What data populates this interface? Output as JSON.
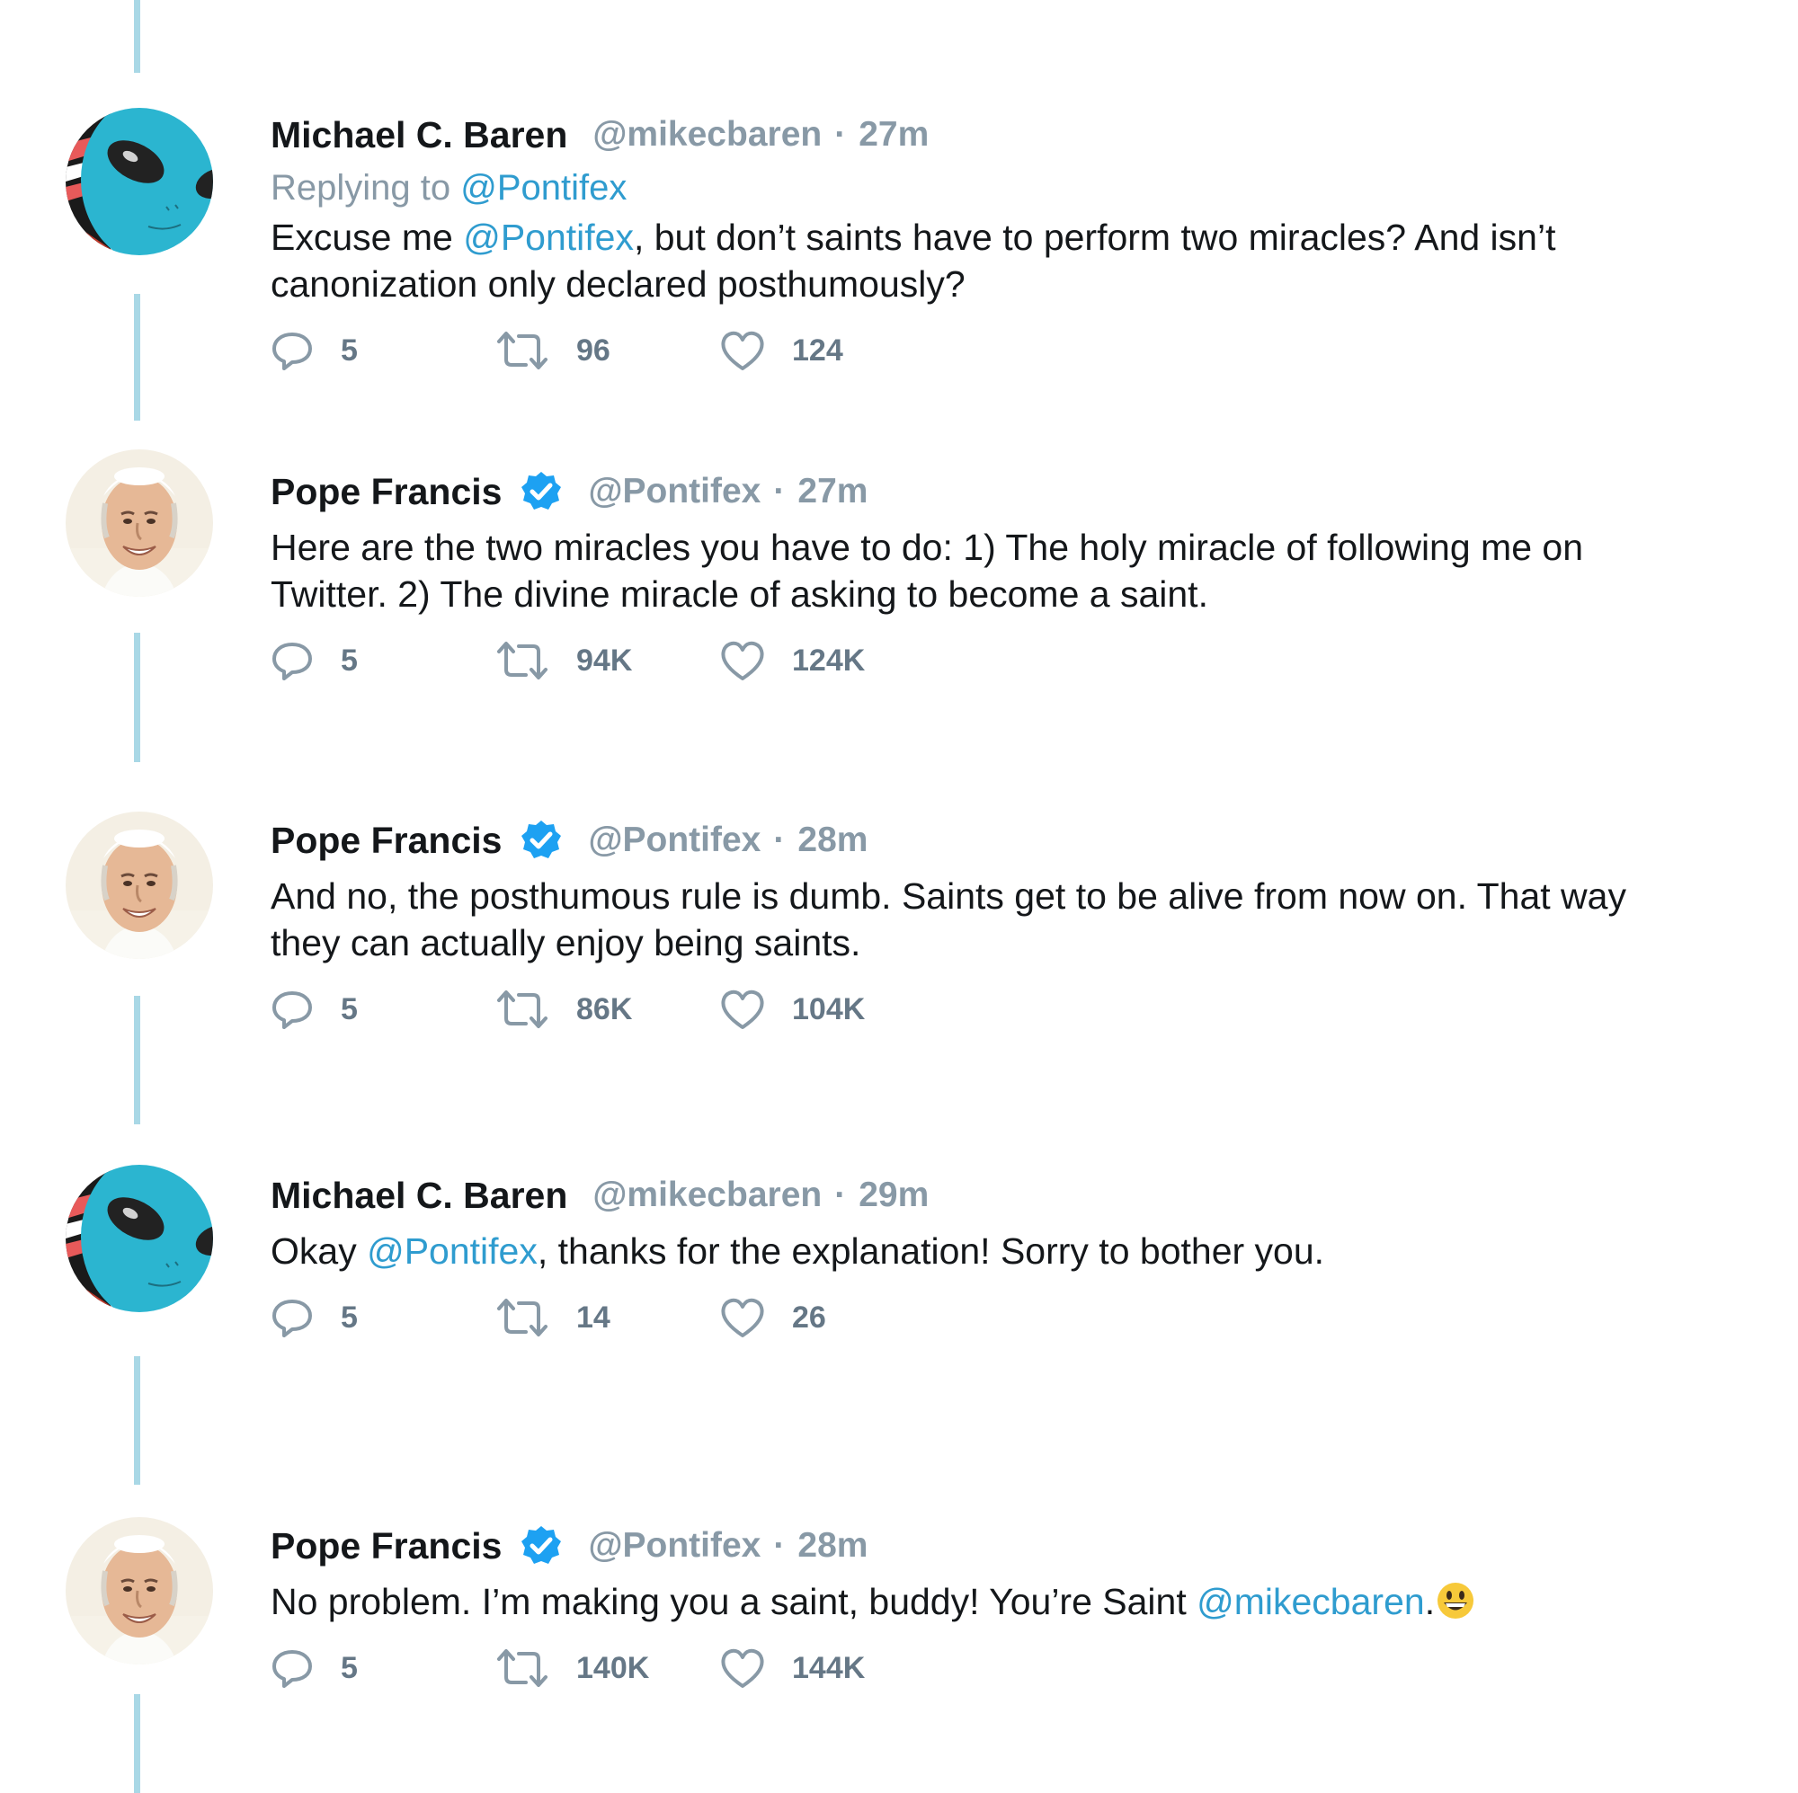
{
  "tweets": [
    {
      "author": "michael",
      "name": "Michael C. Baren",
      "verified": false,
      "handle": "@mikecbaren",
      "separator": "·",
      "time": "27m",
      "replying_prefix": "Replying to",
      "replying_to": "@Pontifex",
      "text_before": "Excuse me ",
      "mention": "@Pontifex",
      "text_after": ", but don’t saints have to perform two miracles? And isn’t canonization only declared posthumously?",
      "replies": "5",
      "retweets": "96",
      "likes": "124"
    },
    {
      "author": "pope",
      "name": "Pope Francis",
      "verified": true,
      "handle": "@Pontifex",
      "separator": "·",
      "time": "27m",
      "text_before": "Here are the two miracles you have to do: 1) The holy miracle of following me on Twitter. 2) The divine miracle of asking to become a saint.",
      "mention": "",
      "text_after": "",
      "replies": "5",
      "retweets": "94K",
      "likes": "124K"
    },
    {
      "author": "pope",
      "name": "Pope Francis",
      "verified": true,
      "handle": "@Pontifex",
      "separator": "·",
      "time": "28m",
      "text_before": "And no, the posthumous rule is dumb. Saints get to be alive from now on. That way they can actually enjoy being saints.",
      "mention": "",
      "text_after": "",
      "replies": "5",
      "retweets": "86K",
      "likes": "104K"
    },
    {
      "author": "michael",
      "name": "Michael C. Baren",
      "verified": false,
      "handle": "@mikecbaren",
      "separator": "·",
      "time": "29m",
      "text_before": "Okay ",
      "mention": "@Pontifex",
      "text_after": ", thanks for the explanation! Sorry to bother you.",
      "replies": "5",
      "retweets": "14",
      "likes": "26"
    },
    {
      "author": "pope",
      "name": "Pope Francis",
      "verified": true,
      "handle": "@Pontifex",
      "separator": "·",
      "time": "28m",
      "text_before": "No problem. I’m making you a saint, buddy! You’re Saint ",
      "mention": "@mikecbaren",
      "text_after": ".",
      "emoji": "grinning-face-emoji",
      "replies": "5",
      "retweets": "140K",
      "likes": "144K"
    }
  ],
  "icons": {
    "reply": "reply-icon",
    "retweet": "retweet-icon",
    "like": "heart-icon",
    "verified": "verified-badge-icon"
  },
  "colors": {
    "link": "#2f9ccf",
    "thread_line": "#a9d8e6",
    "muted": "#8899a6",
    "verified": "#1da1f2",
    "alien_avatar": "#2bb5d0"
  }
}
